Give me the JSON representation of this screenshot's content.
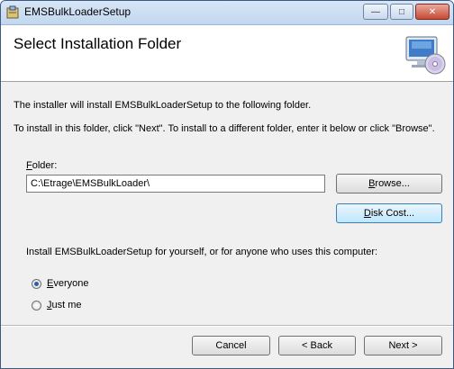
{
  "window": {
    "title": "EMSBulkLoaderSetup",
    "controls": {
      "minimize": "—",
      "maximize": "□",
      "close": "✕"
    }
  },
  "header": {
    "title": "Select Installation Folder",
    "icon": "computer-cd-icon"
  },
  "body": {
    "intro_line1": "The installer will install EMSBulkLoaderSetup to the following folder.",
    "intro_line2": "To install in this folder, click \"Next\". To install to a different folder, enter it below or click \"Browse\".",
    "folder_label": "Folder:",
    "folder_value": "C:\\Etrage\\EMSBulkLoader\\",
    "browse_label": "Browse...",
    "disk_cost_label": "Disk Cost...",
    "install_for_label": "Install EMSBulkLoaderSetup for yourself, or for anyone who uses this computer:",
    "options": [
      {
        "label": "Everyone",
        "checked": true
      },
      {
        "label": "Just me",
        "checked": false
      }
    ]
  },
  "footer": {
    "cancel_label": "Cancel",
    "back_label": "< Back",
    "next_label": "Next >"
  }
}
